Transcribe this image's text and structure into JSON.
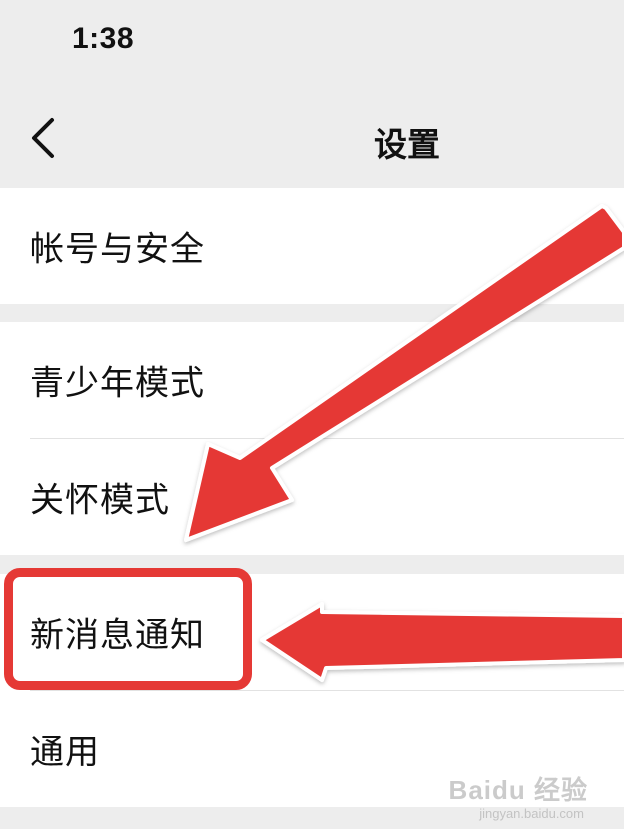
{
  "status_bar": {
    "time": "1:38"
  },
  "nav": {
    "title": "设置",
    "back_icon": "chevron-left-icon"
  },
  "groups": [
    {
      "items": [
        {
          "label": "帐号与安全"
        }
      ]
    },
    {
      "items": [
        {
          "label": "青少年模式"
        },
        {
          "label": "关怀模式"
        }
      ]
    },
    {
      "items": [
        {
          "label": "新消息通知"
        },
        {
          "label": "通用"
        }
      ]
    }
  ],
  "annotation": {
    "color": "#e53935",
    "highlighted_item": "新消息通知"
  },
  "watermark": {
    "text": "Baidu 经验",
    "sub": "jingyan.baidu.com"
  }
}
